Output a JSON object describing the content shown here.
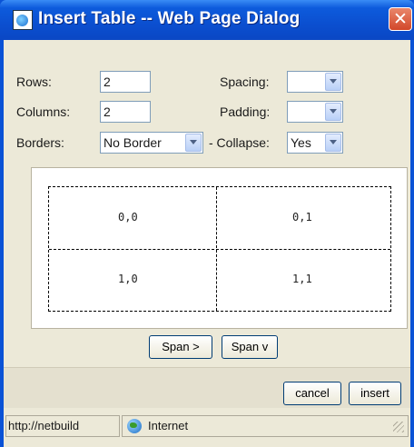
{
  "window": {
    "title": "Insert Table -- Web Page Dialog",
    "close_glyph": "✕"
  },
  "form": {
    "rows_label": "Rows:",
    "rows_value": "2",
    "columns_label": "Columns:",
    "columns_value": "2",
    "borders_label": "Borders:",
    "borders_value": "No Border",
    "spacing_label": "Spacing:",
    "spacing_value": "",
    "padding_label": "Padding:",
    "padding_value": "",
    "collapse_label": "- Collapse:",
    "collapse_value": "Yes"
  },
  "preview": {
    "cells": [
      "0,0",
      "0,1",
      "1,0",
      "1,1"
    ]
  },
  "buttons": {
    "span_right": "Span >",
    "span_down": "Span v",
    "cancel": "cancel",
    "insert": "insert"
  },
  "statusbar": {
    "url": "http://netbuild",
    "zone": "Internet",
    "zone_icon": "globe-icon"
  },
  "colors": {
    "titlebar": "#0b4fd0",
    "dialog_bg": "#ece9d8",
    "close": "#d2472a"
  }
}
